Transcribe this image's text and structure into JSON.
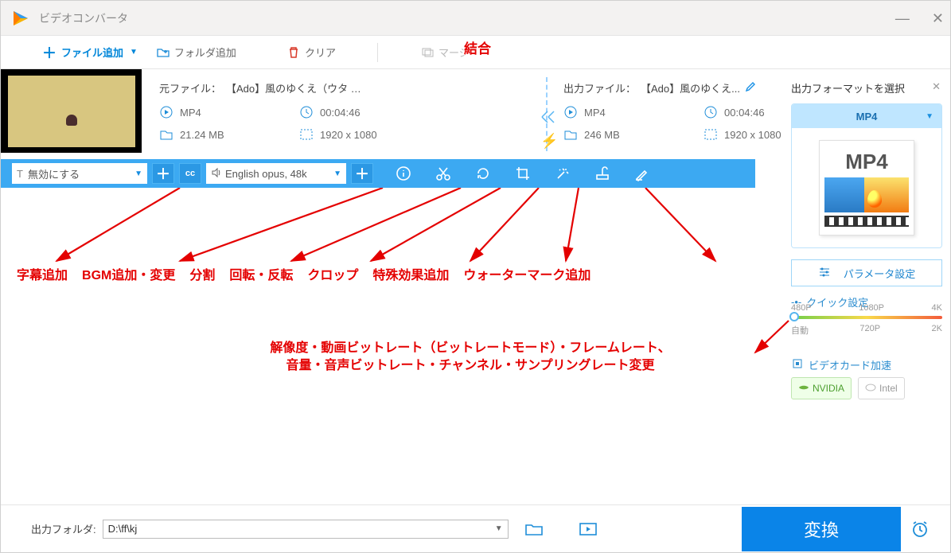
{
  "window": {
    "title": "ビデオコンバータ"
  },
  "annotations": {
    "top": "結合",
    "labels": [
      "字幕追加",
      "BGM追加・変更",
      "分割",
      "回転・反転",
      "クロップ",
      "特殊効果追加",
      "ウォーターマーク追加"
    ],
    "params_line1": "解像度・動画ビットレート（ビットレートモード）・フレームレート、",
    "params_line2": "音量・音声ビットレート・チャンネル・サンプリングレート変更"
  },
  "toolbar": {
    "add_file": "ファイル追加",
    "add_folder": "フォルダ追加",
    "clear": "クリア",
    "merge": "マージ"
  },
  "file": {
    "source": {
      "label": "元ファイル：",
      "name": "【Ado】風のゆくえ（ウタ …",
      "format": "MP4",
      "duration": "00:04:46",
      "size": "21.24 MB",
      "resolution": "1920 x 1080"
    },
    "output": {
      "label": "出力ファイル：",
      "name": "【Ado】風のゆくえ...",
      "format": "MP4",
      "duration": "00:04:46",
      "size": "246 MB",
      "resolution": "1920 x 1080"
    }
  },
  "actionbar": {
    "subtitle_select": "無効にする",
    "audio_select": "English opus, 48k"
  },
  "sidebar": {
    "title": "出力フォーマットを選択",
    "format": "MP4",
    "format_card": "MP4",
    "param_btn": "パラメータ設定",
    "quick_title": "クイック設定",
    "res_top": [
      "480P",
      "1080P",
      "4K"
    ],
    "res_bot": [
      "自動",
      "720P",
      "2K"
    ],
    "gpu_title": "ビデオカード加速",
    "gpu_nvidia": "NVIDIA",
    "gpu_intel": "Intel"
  },
  "footer": {
    "label": "出力フォルダ:",
    "path": "D:\\ff\\kj",
    "convert": "変換"
  }
}
